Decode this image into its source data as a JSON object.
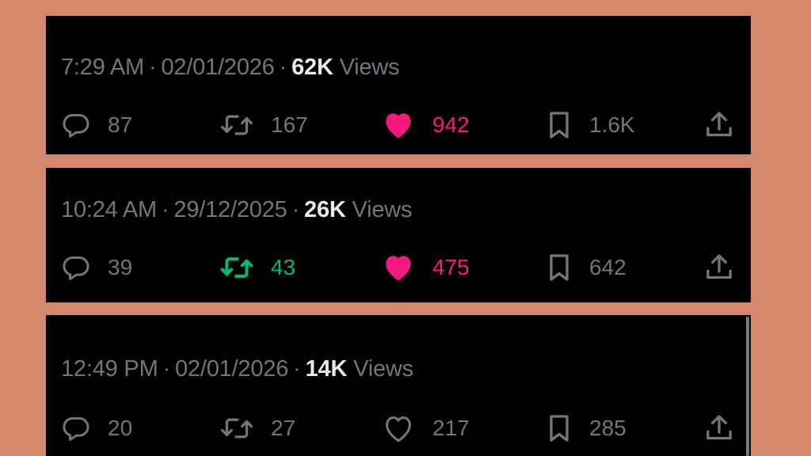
{
  "colors": {
    "background": "#D4876A",
    "card": "#000000",
    "muted": "#71767B",
    "bright": "#E7E9EA",
    "like_active": "#F91880",
    "retweet_active": "#00BA7C"
  },
  "posts": [
    {
      "time": "7:29 AM",
      "separator": "·",
      "date": "02/01/2026",
      "views_count": "62K",
      "views_label": "Views",
      "replies": "87",
      "retweets": "167",
      "retweeted": false,
      "likes": "942",
      "liked": true,
      "bookmarks": "1.6K"
    },
    {
      "time": "10:24 AM",
      "separator": "·",
      "date": "29/12/2025",
      "views_count": "26K",
      "views_label": "Views",
      "replies": "39",
      "retweets": "43",
      "retweeted": true,
      "likes": "475",
      "liked": true,
      "bookmarks": "642"
    },
    {
      "time": "12:49 PM",
      "separator": "·",
      "date": "02/01/2026",
      "views_count": "14K",
      "views_label": "Views",
      "replies": "20",
      "retweets": "27",
      "retweeted": false,
      "likes": "217",
      "liked": false,
      "bookmarks": "285"
    }
  ],
  "icons": {
    "reply": "reply-icon",
    "retweet": "retweet-icon",
    "like": "heart-icon",
    "bookmark": "bookmark-icon",
    "share": "share-icon"
  }
}
